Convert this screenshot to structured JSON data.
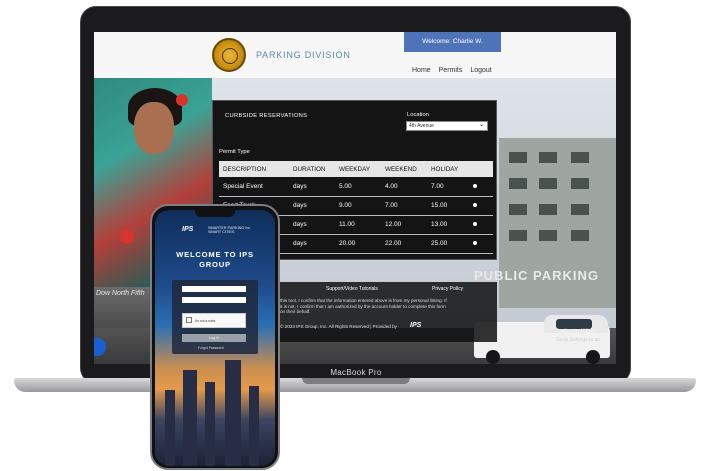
{
  "site": {
    "division_title": "PARKING DIVISION",
    "welcome": "Welcome: Charlie W.",
    "nav": [
      "Home",
      "Permits",
      "Logout"
    ]
  },
  "reservations": {
    "title": "CURBSIDE RESERVATIONS",
    "location_label": "Location",
    "location_value": "4th Avenue",
    "permit_type_label": "Permit Type",
    "columns": [
      "DESCRIPTION",
      "DURATION",
      "WEEKDAY",
      "WEEKEND",
      "HOLIDAY"
    ],
    "rows": [
      {
        "description": "Special Event",
        "duration": "days",
        "weekday": "5.00",
        "weekend": "4.00",
        "holiday": "7.00"
      },
      {
        "description": "Food Truck",
        "duration": "days",
        "weekday": "9.00",
        "weekend": "7.00",
        "holiday": "15.00"
      },
      {
        "description": "",
        "duration": "days",
        "weekday": "11.00",
        "weekend": "12.00",
        "holiday": "13.00"
      },
      {
        "description": "",
        "duration": "days",
        "weekday": "20.00",
        "weekend": "22.00",
        "holiday": "25.00"
      }
    ]
  },
  "footer": {
    "support": "Support/Video Tutorials",
    "privacy": "Privacy Policy",
    "agreement": "this tool, I confirm that the information entered above is from my personal listing. If it is not, I confirm that I am authorized by the account holder to complete this form on their behalf.",
    "copyright": "© 2023 IPS Group, Inc. All Rights Reserved  |  Provided by",
    "provider_logo": "IPS"
  },
  "background": {
    "mural_text": "Dow North Fifth",
    "garage_sign": "PUBLIC PARKING",
    "watermark": "Activate Wind",
    "watermark_sub": "Go to Settings to ac"
  },
  "laptop": {
    "label": "MacBook Pro"
  },
  "phone": {
    "logo": "IPS",
    "tagline": "SMARTER PARKING for SMART CITIES",
    "welcome": "WELCOME TO IPS GROUP",
    "recaptcha": "I'm not a robot",
    "login_button": "Log in",
    "forgot": "Forgot Password"
  }
}
